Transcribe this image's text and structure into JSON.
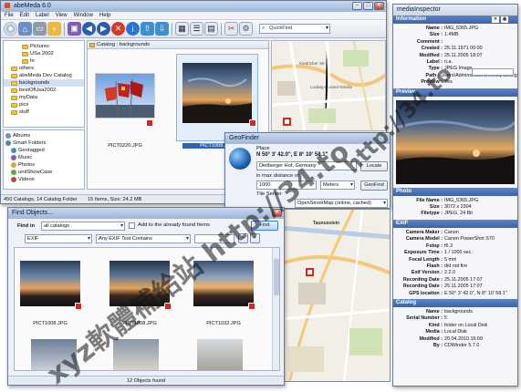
{
  "main_window": {
    "title": "abeMeda 6.0",
    "menu": [
      "File",
      "Edit",
      "Label",
      "View",
      "Window",
      "Help"
    ],
    "quickfind_placeholder": "QuickFind",
    "tree": [
      {
        "label": "Pictures",
        "indent": 3
      },
      {
        "label": "USa 2002",
        "indent": 3
      },
      {
        "label": "hr",
        "indent": 3
      },
      {
        "label": "others",
        "indent": 1
      },
      {
        "label": "abeMeda Dev Catalog",
        "indent": 1
      },
      {
        "label": "backgrounds",
        "indent": 1,
        "selected": true
      },
      {
        "label": "bestOfUsa2002",
        "indent": 1
      },
      {
        "label": "myData",
        "indent": 1
      },
      {
        "label": "pics",
        "indent": 1
      },
      {
        "label": "stuff",
        "indent": 1
      }
    ],
    "smart": [
      {
        "label": "Albums"
      },
      {
        "label": "Smart Folders"
      },
      {
        "label": "Geotagged"
      },
      {
        "label": "Music"
      },
      {
        "label": "Photos"
      },
      {
        "label": "unitShowCase"
      },
      {
        "label": "Videos"
      }
    ],
    "breadcrumb": "Catalog : backgrounds",
    "photos": [
      {
        "caption": "PICT0220.JPG"
      },
      {
        "caption": "PICT1008.JPG"
      }
    ],
    "status_left": "450 Catalogs, 14 Catalog Folder",
    "status_mid": "15 Items, Size: 24.2 MB"
  },
  "geofinder": {
    "title": "GeoFinder",
    "place_label": "Place",
    "coords": "N 50° 3' 42.0\", E 8° 10' 58.1\"",
    "address": "Dietberger Hof, Germany",
    "locate_button": "Locate",
    "range_label": "in max distance of",
    "range_value": "1000",
    "unit": "Meters",
    "geofind_button": "GeoFind",
    "tile_label": "Tile Server",
    "tile_value": "OpenStreetMap (online, cached)"
  },
  "map": {
    "labels": [
      "Kiedricher Str.",
      "Ludwig-Kurand-Straße",
      "Taunusstein"
    ]
  },
  "find_objects": {
    "title": "Find Objects...",
    "find_in_label": "Find in",
    "find_in_value": "all catalogs",
    "checkbox_label": "Add to the already found Items",
    "find_button": "Find",
    "filter_category": "EXIF",
    "filter_field": "Any EXIF Text Contains",
    "results": [
      {
        "caption": "PICT1008.JPG"
      },
      {
        "caption": "PICT1008.JPG"
      },
      {
        "caption": "PICT1032.JPG"
      }
    ],
    "status": "12 Objects found"
  },
  "inspector": {
    "title": "mediaInspector",
    "information_title": "Information",
    "information": [
      {
        "k": "Name :",
        "v": "IMG_5365.JPG"
      },
      {
        "k": "Size :",
        "v": "1.4MB"
      },
      {
        "k": "Comment :",
        "v": ""
      },
      {
        "k": "",
        "v": ""
      },
      {
        "k": "Created :",
        "v": "25.11.1971 00:00"
      },
      {
        "k": "Modified :",
        "v": "25.11.2005 18:07"
      },
      {
        "k": "Label :",
        "v": "n.a."
      },
      {
        "k": "Type :",
        "v": "JPEG Image"
      },
      {
        "k": "Path :",
        "v": "Users\\Adminstrator\\Desktop\\backgr..."
      },
      {
        "k": "Preview :",
        "v": "Yes"
      }
    ],
    "preview_title": "Preview",
    "photo_title": "Photo",
    "photo": [
      {
        "k": "File Name :",
        "v": "IMG_5365.JPG"
      },
      {
        "k": "Size :",
        "v": "3072 x 2304"
      },
      {
        "k": "Filetype :",
        "v": "JPEG, 24 Bit"
      }
    ],
    "exif_title": "EXIF",
    "exif": [
      {
        "k": "Camera Maker :",
        "v": "Canon"
      },
      {
        "k": "Camera Model :",
        "v": "Canon PowerShot S70"
      },
      {
        "k": "Fstop :",
        "v": "f6.3"
      },
      {
        "k": "Exposure Time :",
        "v": "1 / 1000 sec."
      },
      {
        "k": "Focal Length :",
        "v": "5 mm"
      },
      {
        "k": "Flash :",
        "v": "did not fire"
      },
      {
        "k": "Exif Version :",
        "v": "2.2.0"
      },
      {
        "k": "Recording Date :",
        "v": "25.11.2005 17:07"
      },
      {
        "k": "Recording Date :",
        "v": "25.11.2005 17:07"
      },
      {
        "k": "GPS location :",
        "v": "E 50° 3' 42.0\", N 8° 10' 58.1\""
      }
    ],
    "catalog_title": "Catalog",
    "catalog": [
      {
        "k": "Name :",
        "v": "backgrounds"
      },
      {
        "k": "Serial Number :",
        "v": "5"
      },
      {
        "k": "Kind :",
        "v": "folder on Local Disk"
      },
      {
        "k": "Media :",
        "v": "Local Disk"
      },
      {
        "k": "Modified :",
        "v": "20.04.2010 16:09"
      },
      {
        "k": "By :",
        "v": "CDWinder 5.7.0"
      }
    ]
  },
  "watermarks": {
    "a": "xyz軟體補給站 http://34.to",
    "b": "http://34.to"
  },
  "colors": {
    "accent": "#3b63a6",
    "selection": "#cfe0f7",
    "badge": "#d9261c"
  }
}
